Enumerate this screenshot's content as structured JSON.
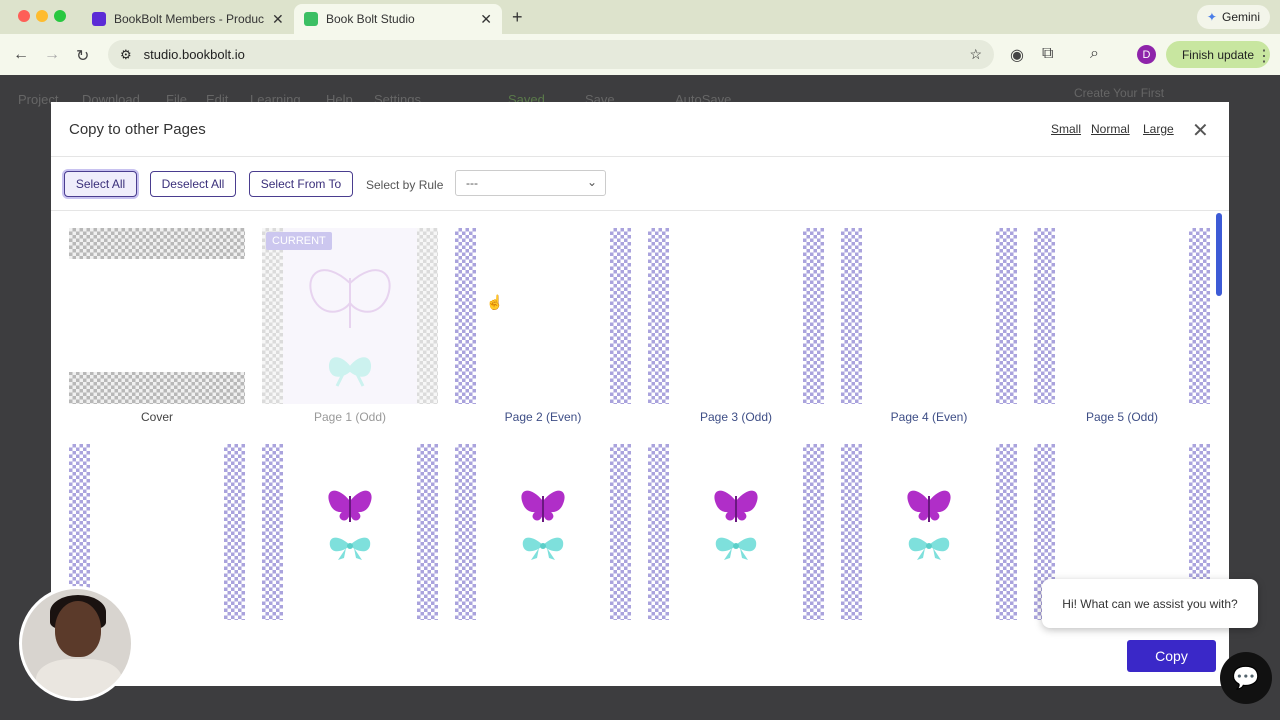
{
  "browser": {
    "tabs": [
      {
        "title": "BookBolt Members - Product",
        "favicon_color": "#5b2bd6"
      },
      {
        "title": "Book Bolt Studio",
        "favicon_color": "#3bbf63"
      }
    ],
    "gemini_label": "Gemini",
    "url": "studio.bookbolt.io",
    "profile_initial": "D",
    "finish_update_label": "Finish update"
  },
  "app_background": {
    "menu": [
      "Project",
      "Download",
      "File",
      "Edit",
      "Learning",
      "Help",
      "Settings"
    ],
    "saved_label": "Saved",
    "save_label": "Save",
    "autosave_label": "AutoSave",
    "create_label": "Create Your First"
  },
  "modal": {
    "title": "Copy to other Pages",
    "sizes": {
      "small": "Small",
      "normal": "Normal",
      "large": "Large"
    },
    "buttons": {
      "select_all": "Select All",
      "deselect_all": "Deselect All",
      "select_from_to": "Select From To"
    },
    "select_by_rule_label": "Select by Rule",
    "select_by_rule_value": "---",
    "current_badge": "CURRENT",
    "pages_row1": [
      "Cover",
      "Page 1 (Odd)",
      "Page 2 (Even)",
      "Page 3 (Odd)",
      "Page 4 (Even)",
      "Page 5 (Odd)"
    ],
    "copy_button": "Copy"
  },
  "chat": {
    "message": "Hi! What can we assist you with?"
  },
  "colors": {
    "accent": "#3a28c8",
    "checker_purple": "#aaa3dd",
    "butterfly": "#b02ec8",
    "bow": "#7ee0dc"
  }
}
